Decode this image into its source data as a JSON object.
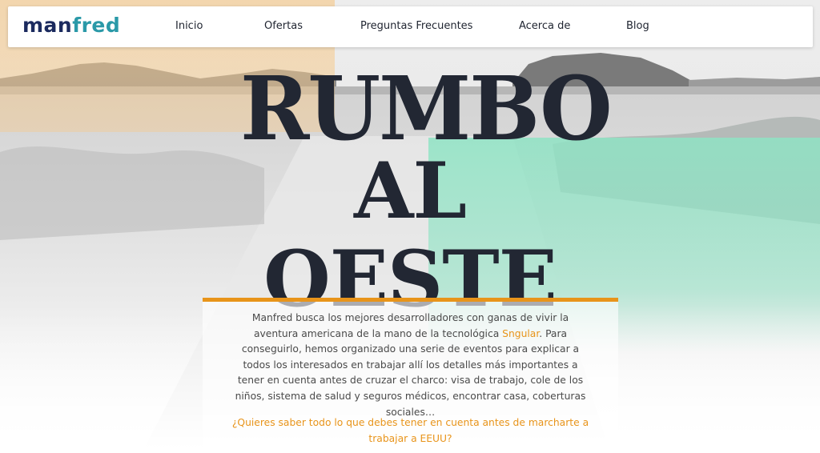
{
  "nav": {
    "logo_part1": "man",
    "logo_part2": "fred",
    "items": [
      "Inicio",
      "Ofertas",
      "Preguntas Frecuentes",
      "Acerca de",
      "Blog"
    ]
  },
  "hero": {
    "title_line1": "RUMBO",
    "title_line2": "AL OESTE"
  },
  "content": {
    "text_before_link": "Manfred busca los mejores desarrolladores con ganas de vivir la aventura americana de la mano de la tecnológica ",
    "link_text": "Sngular",
    "text_after_link": ". Para conseguirlo, hemos organizado una serie de eventos para explicar a todos los interesados en trabajar allí los detalles más importantes a tener en cuenta antes de cruzar el charco: visa de trabajo, cole de los niños, sistema de salud y seguros médicos, encontrar casa, coberturas sociales…",
    "cta": "¿Quieres saber todo lo que debes tener en cuenta antes de marcharte a trabajar a EEUU?"
  },
  "colors": {
    "brand_dark": "#1b2a5e",
    "brand_teal": "#2a99a8",
    "accent_orange": "#e8941a",
    "title_dark": "#222733",
    "tint_orange": "#f6c98a",
    "tint_mint": "#8fe3c4"
  }
}
